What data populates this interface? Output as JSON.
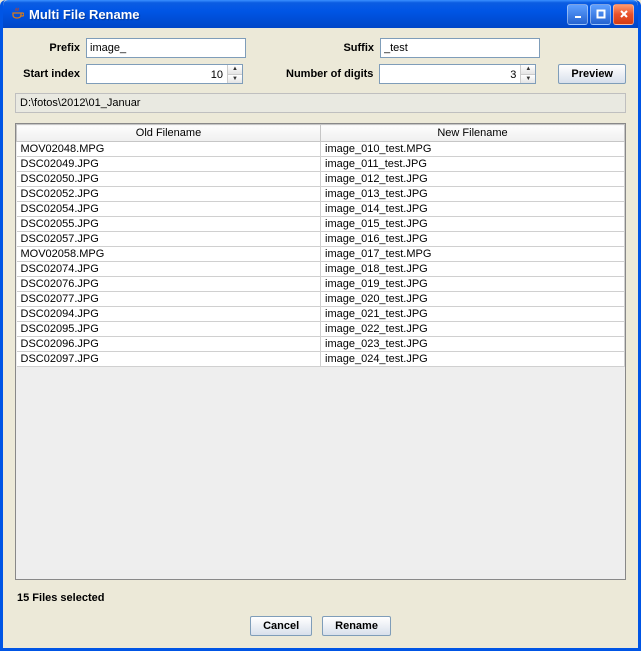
{
  "window": {
    "title": "Multi File Rename"
  },
  "form": {
    "prefix_label": "Prefix",
    "prefix_value": "image_",
    "suffix_label": "Suffix",
    "suffix_value": "_test",
    "start_label": "Start index",
    "start_value": "10",
    "digits_label": "Number of digits",
    "digits_value": "3",
    "preview_label": "Preview"
  },
  "path": "D:\\fotos\\2012\\01_Januar",
  "columns": {
    "old": "Old Filename",
    "new": "New Filename"
  },
  "rows": [
    {
      "old": "MOV02048.MPG",
      "new": "image_010_test.MPG"
    },
    {
      "old": "DSC02049.JPG",
      "new": "image_011_test.JPG"
    },
    {
      "old": "DSC02050.JPG",
      "new": "image_012_test.JPG"
    },
    {
      "old": "DSC02052.JPG",
      "new": "image_013_test.JPG"
    },
    {
      "old": "DSC02054.JPG",
      "new": "image_014_test.JPG"
    },
    {
      "old": "DSC02055.JPG",
      "new": "image_015_test.JPG"
    },
    {
      "old": "DSC02057.JPG",
      "new": "image_016_test.JPG"
    },
    {
      "old": "MOV02058.MPG",
      "new": "image_017_test.MPG"
    },
    {
      "old": "DSC02074.JPG",
      "new": "image_018_test.JPG"
    },
    {
      "old": "DSC02076.JPG",
      "new": "image_019_test.JPG"
    },
    {
      "old": "DSC02077.JPG",
      "new": "image_020_test.JPG"
    },
    {
      "old": "DSC02094.JPG",
      "new": "image_021_test.JPG"
    },
    {
      "old": "DSC02095.JPG",
      "new": "image_022_test.JPG"
    },
    {
      "old": "DSC02096.JPG",
      "new": "image_023_test.JPG"
    },
    {
      "old": "DSC02097.JPG",
      "new": "image_024_test.JPG"
    }
  ],
  "status": "15 Files selected",
  "buttons": {
    "cancel": "Cancel",
    "rename": "Rename"
  }
}
